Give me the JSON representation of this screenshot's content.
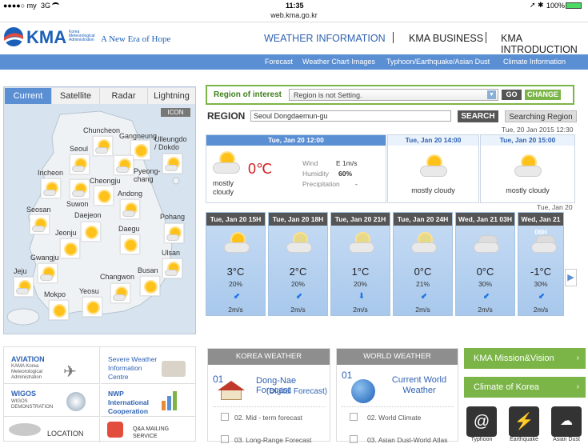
{
  "status": {
    "carrier": "●●●●○ my",
    "network": "3G",
    "time": "11:35",
    "battery": "100%"
  },
  "url": "web.kma.go.kr",
  "header": {
    "logo_text": "KMA",
    "logo_sub1": "Korea",
    "logo_sub2": "Meteorological",
    "logo_sub3": "Administration",
    "slogan": "A New Era of Hope",
    "nav": [
      "WEATHER INFORMATION",
      "KMA BUSINESS",
      "KMA INTRODUCTION"
    ]
  },
  "subnav": [
    "Forecast",
    "Weather Chart·Images",
    "Typhoon/Earthquake/Asian Dust",
    "Climate Information"
  ],
  "map": {
    "tabs": [
      "Current",
      "Satellite",
      "Radar",
      "Lightning"
    ],
    "icon_label": "ICON",
    "cities": [
      "Chuncheon",
      "Gangneung",
      "Ulleungdo / Dokdo",
      "Seoul",
      "Incheon",
      "Pyeong-chang",
      "Suwon",
      "Cheongju",
      "Andong",
      "Seosan",
      "Daejeon",
      "Pohang",
      "Jeonju",
      "Daegu",
      "Gwangju",
      "Ulsan",
      "Jeju",
      "Busan",
      "Changwon",
      "Mokpo",
      "Yeosu"
    ]
  },
  "region": {
    "roi_label": "Region of interest",
    "roi_value": "Region is not Setting.",
    "go": "GO",
    "change": "CHANGE",
    "label": "REGION",
    "search_value": "Seoul Dongdaemun-gu",
    "search": "SEARCH",
    "searching": "Searching Region",
    "updated": "Tue, 20 Jan 2015 12:30"
  },
  "current": {
    "cards": [
      {
        "time": "Tue, Jan 20  12:00",
        "temp": "0℃",
        "desc": "mostly cloudy"
      },
      {
        "time": "Tue, Jan 20  14:00",
        "desc": "mostly cloudy"
      },
      {
        "time": "Tue, Jan 20  15:00",
        "desc": "mostly cloudy"
      }
    ],
    "wind_label": "Wind",
    "wind": "E  1m/s",
    "humidity_label": "Humidity",
    "humidity": "60%",
    "precip_label": "Precipitation",
    "precip": "-"
  },
  "forecast_date": "Tue, Jan 20",
  "forecast": [
    {
      "time": "Tue, Jan 20 15H",
      "temp": "3°C",
      "pct": "20%",
      "wind": "2m/s"
    },
    {
      "time": "Tue, Jan 20 18H",
      "temp": "2°C",
      "pct": "20%",
      "wind": "2m/s"
    },
    {
      "time": "Tue, Jan 20 21H",
      "temp": "1°C",
      "pct": "20%",
      "wind": "2m/s"
    },
    {
      "time": "Tue, Jan 20 24H",
      "temp": "0°C",
      "pct": "21%",
      "wind": "2m/s"
    },
    {
      "time": "Wed, Jan 21 03H",
      "temp": "0°C",
      "pct": "30%",
      "wind": "2m/s"
    },
    {
      "time": "Wed, Jan 21 06H",
      "temp": "-1°C",
      "pct": "30%",
      "wind": "2m/s"
    }
  ],
  "links": {
    "aviation_title": "AVIATION",
    "aviation_sub": "KAMA Korea Meteorological Administration",
    "severe_title": "Severe Weather Information Centre",
    "wigos_title": "WIGOS",
    "wigos_sub": "WIGOS DEMONSTRATION",
    "nwp_title": "NWP International Cooperation",
    "location": "LOCATION",
    "qa": "Q&A MAILING SERVICE"
  },
  "korea_weather": {
    "title": "KOREA WEATHER",
    "num": "01",
    "main": "Dong-Nae Forecast",
    "main_sub": "(Digital Forecast)",
    "item2": "02. Mid - term  forecast",
    "item3": "03. Long-Range Forecast"
  },
  "world_weather": {
    "title": "WORLD WEATHER",
    "num": "01",
    "main": "Current World Weather",
    "item2": "02. World Climate",
    "item3": "03. Asian Dust-World Atlas"
  },
  "kma_links": [
    "KMA Mission&Vision",
    "Climate of Korea"
  ],
  "bottom_icons": [
    "Typhoon",
    "Earthquake",
    "Asian Dust"
  ]
}
